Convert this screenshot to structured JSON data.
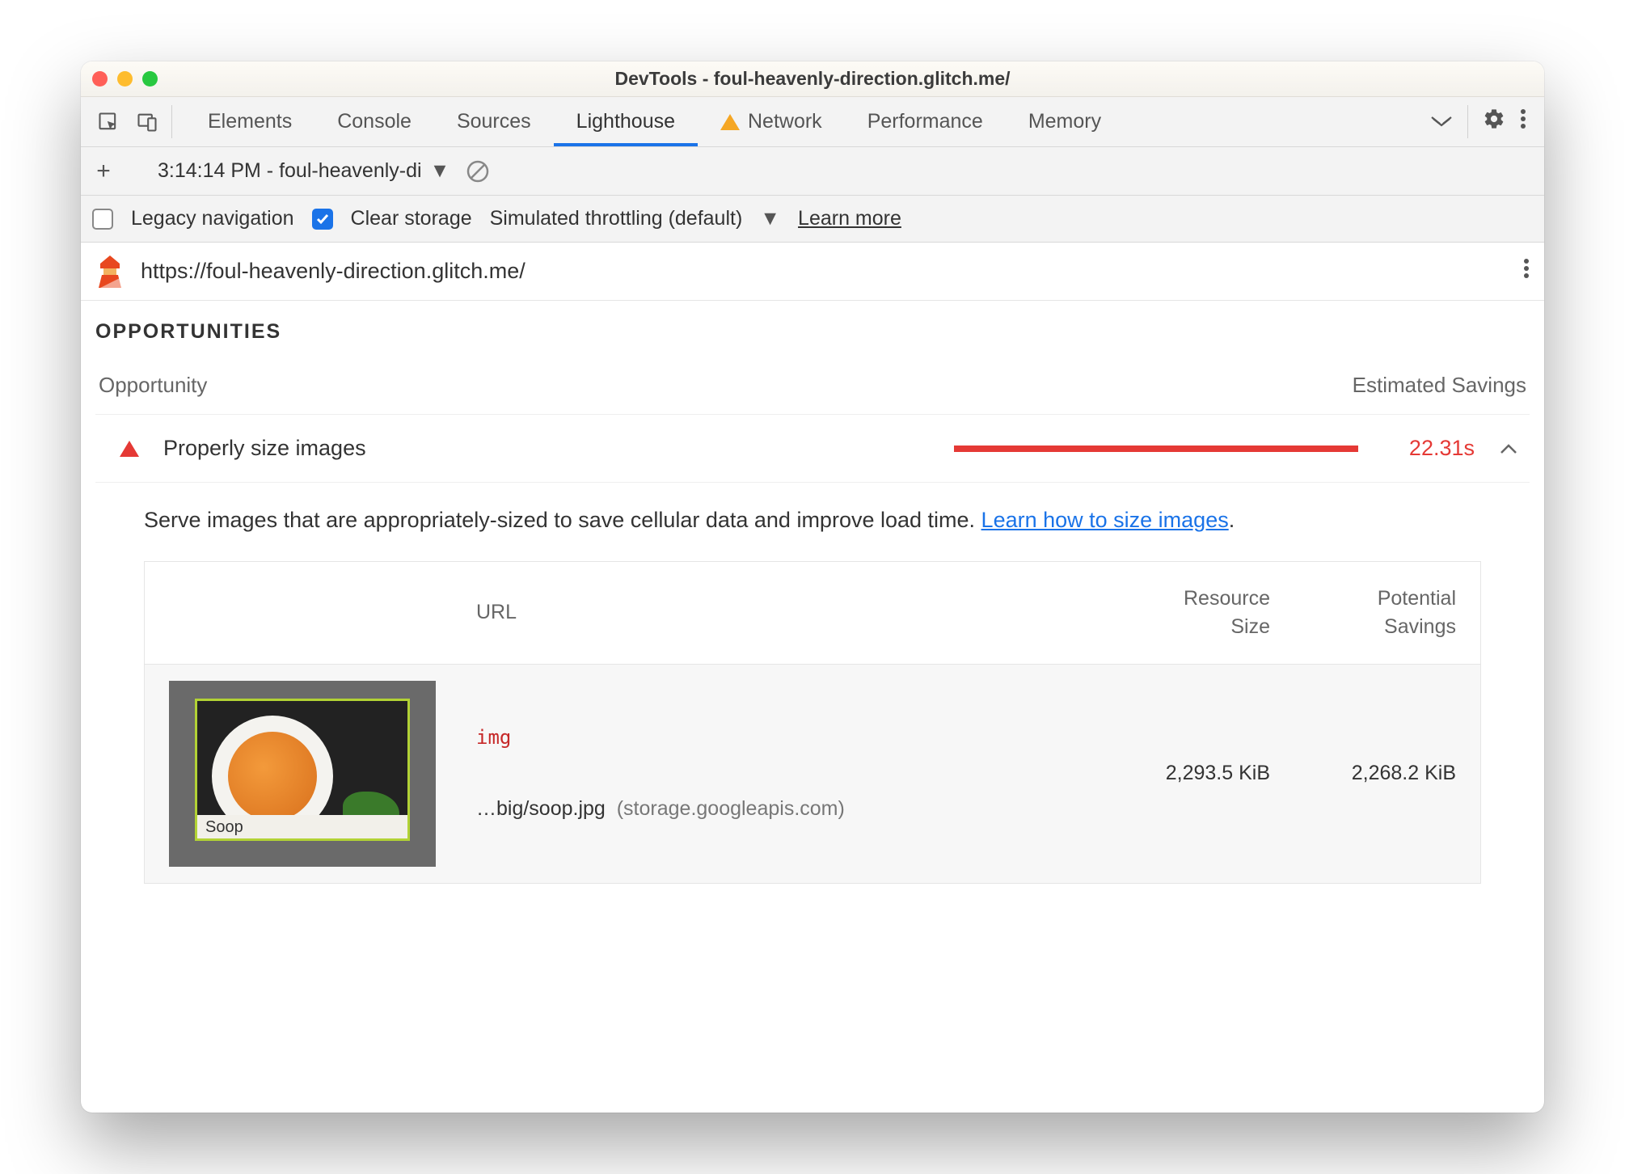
{
  "window": {
    "title": "DevTools - foul-heavenly-direction.glitch.me/"
  },
  "tabs": {
    "items": [
      "Elements",
      "Console",
      "Sources",
      "Lighthouse",
      "Network",
      "Performance",
      "Memory"
    ],
    "active": "Lighthouse",
    "warning_on": "Network"
  },
  "subbar": {
    "run_label": "3:14:14 PM - foul-heavenly-di"
  },
  "options": {
    "legacy_label": "Legacy navigation",
    "legacy_checked": false,
    "clear_label": "Clear storage",
    "clear_checked": true,
    "throttling_label": "Simulated throttling (default)",
    "learn_more": "Learn more"
  },
  "page": {
    "url": "https://foul-heavenly-direction.glitch.me/"
  },
  "report": {
    "section": "OPPORTUNITIES",
    "col_opportunity": "Opportunity",
    "col_savings": "Estimated Savings",
    "item": {
      "name": "Properly size images",
      "value": "22.31s",
      "description_pre": "Serve images that are appropriately-sized to save cellular data and improve load time. ",
      "description_link": "Learn how to size images",
      "description_post": "."
    },
    "table": {
      "col_url": "URL",
      "col_size_l1": "Resource",
      "col_size_l2": "Size",
      "col_save_l1": "Potential",
      "col_save_l2": "Savings",
      "row": {
        "tag": "img",
        "path": "…big/soop.jpg",
        "host": "(storage.googleapis.com)",
        "thumb_caption": "Soop",
        "resource_size": "2,293.5 KiB",
        "potential_savings": "2,268.2 KiB"
      }
    }
  }
}
